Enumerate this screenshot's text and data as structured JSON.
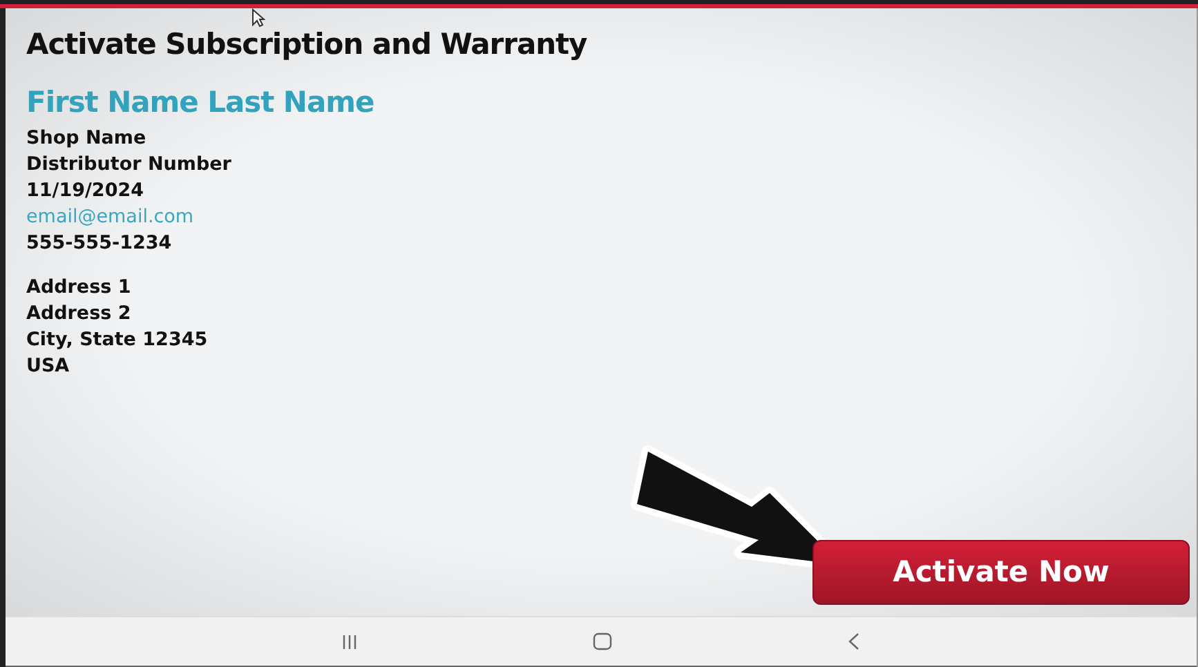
{
  "title": "Activate Subscription and Warranty",
  "name": "First Name Last Name",
  "details": [
    {
      "kind": "text",
      "text": "Shop Name"
    },
    {
      "kind": "text",
      "text": "Distributor Number"
    },
    {
      "kind": "text",
      "text": "11/19/2024"
    },
    {
      "kind": "email",
      "text": "email@email.com"
    },
    {
      "kind": "text",
      "text": "555-555-1234"
    }
  ],
  "address": [
    "Address 1",
    "Address 2",
    "City, State 12345",
    "USA"
  ],
  "button": "Activate Now"
}
